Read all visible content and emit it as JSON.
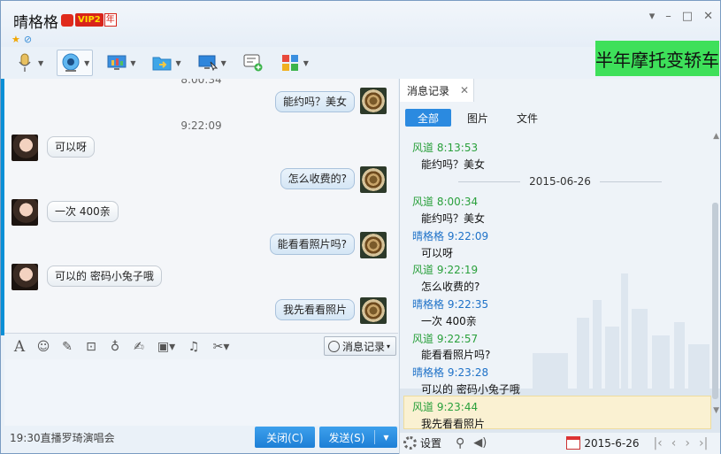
{
  "title": {
    "name": "晴格格",
    "vip_label": "VIP2",
    "vip_year": "年"
  },
  "window_controls": [
    "▾",
    "–",
    "□",
    "✕"
  ],
  "toolbar": {
    "icons": [
      "microphone-icon",
      "webcam-icon",
      "screen-share-icon",
      "file-transfer-icon",
      "remote-desktop-icon",
      "add-note-icon",
      "apps-icon"
    ]
  },
  "ad_text": "半年摩托变轿车",
  "chat": {
    "partial_timestamp": "8:00:34",
    "timestamp": "9:22:09",
    "messages": [
      {
        "side": "right",
        "text": "能约吗？美女"
      },
      {
        "side": "left",
        "text": "可以呀"
      },
      {
        "side": "right",
        "text": "怎么收费的?"
      },
      {
        "side": "left",
        "text": "一次  400亲"
      },
      {
        "side": "right",
        "text": "能看看照片吗?"
      },
      {
        "side": "left",
        "text": "可以的  密码小兔子哦"
      },
      {
        "side": "right",
        "text": "我先看看照片"
      }
    ]
  },
  "input_toolbar": {
    "history_button": "消息记录"
  },
  "bottom": {
    "status_text": "19:30直播罗琦演唱会",
    "close_label": "关闭(C)",
    "send_label": "发送(S)"
  },
  "history": {
    "tab_label": "消息记录",
    "filters": [
      "全部",
      "图片",
      "文件"
    ],
    "date_separator": "2015-06-26",
    "entries": [
      {
        "name": "风道",
        "time": "8:13:53",
        "color": "g",
        "text": "能约吗？美女"
      },
      {
        "name": "风道",
        "time": "8:00:34",
        "color": "g",
        "text": "能约吗？美女"
      },
      {
        "name": "晴格格",
        "time": "9:22:09",
        "color": "b",
        "text": "可以呀"
      },
      {
        "name": "风道",
        "time": "9:22:19",
        "color": "g",
        "text": "怎么收费的?"
      },
      {
        "name": "晴格格",
        "time": "9:22:35",
        "color": "b",
        "text": "一次  400亲"
      },
      {
        "name": "风道",
        "time": "9:22:57",
        "color": "g",
        "text": "能看看照片吗?"
      },
      {
        "name": "晴格格",
        "time": "9:23:28",
        "color": "b",
        "text": "可以的  密码小兔子哦"
      },
      {
        "name": "风道",
        "time": "9:23:44",
        "color": "g",
        "text": "我先看看照片"
      }
    ],
    "settings_label": "设置",
    "date_value": "2015-6-26"
  },
  "colors": {
    "accent_blue": "#2b8ae0",
    "sender_green": "#2aa03c",
    "receiver_blue": "#1f72c8",
    "ad_green": "#3ee05a"
  }
}
